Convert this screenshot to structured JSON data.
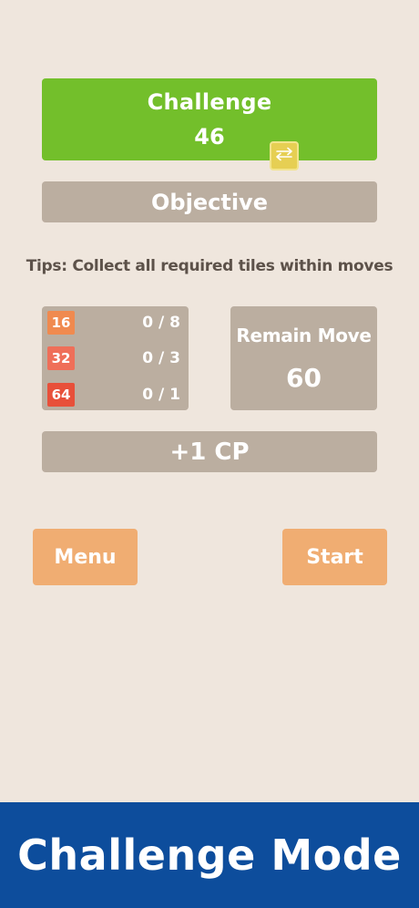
{
  "challenge": {
    "title": "Challenge",
    "number": "46",
    "swap_icon": "swap-arrows-icon",
    "color": "#73bf2b"
  },
  "objective": {
    "label": "Objective"
  },
  "tips": {
    "text": "Tips: Collect all required tiles within moves"
  },
  "requirements": [
    {
      "tile": "16",
      "progress": "0 / 8",
      "color": "#f08a4f"
    },
    {
      "tile": "32",
      "progress": "0 / 3",
      "color": "#ef6f59"
    },
    {
      "tile": "64",
      "progress": "0 / 1",
      "color": "#e8503a"
    }
  ],
  "remain": {
    "label": "Remain Move",
    "value": "60"
  },
  "reward": {
    "label": "+1 CP"
  },
  "buttons": {
    "menu": "Menu",
    "start": "Start"
  },
  "footer": {
    "title": "Challenge Mode",
    "color": "#0d4d9c"
  }
}
